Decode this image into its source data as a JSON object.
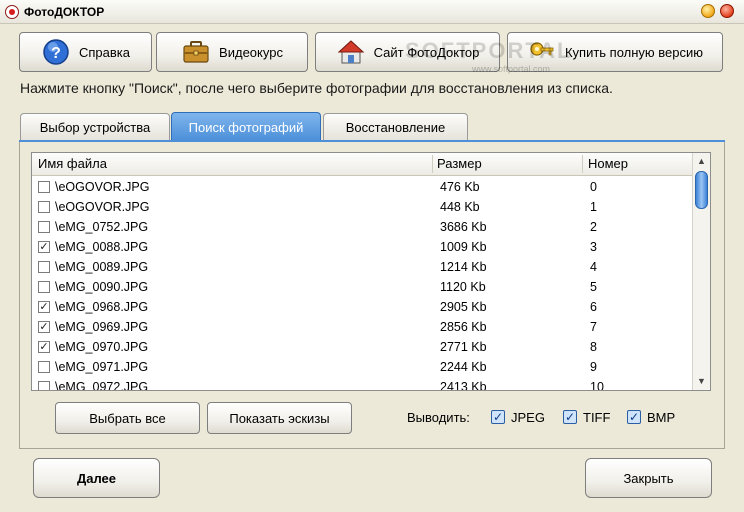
{
  "window": {
    "title": "ФотоДОКТОР"
  },
  "toolbar": {
    "help_label": "Справка",
    "video_label": "Видеокурс",
    "site_label": "Сайт ФотоДоктор",
    "buy_label": "Купить полную версию"
  },
  "watermark": {
    "text": "SOFTPORTAL",
    "url": "www.softportal.com"
  },
  "hint": "Нажмите кнопку \"Поиск\", после чего выберите фотографии для восстановления из списка.",
  "tabs": [
    {
      "label": "Выбор устройства",
      "active": false
    },
    {
      "label": "Поиск фотографий",
      "active": true
    },
    {
      "label": "Восстановление",
      "active": false
    }
  ],
  "table": {
    "columns": [
      "Имя файла",
      "Размер",
      "Номер"
    ],
    "rows": [
      {
        "name": "\\eOGOVOR.JPG",
        "size": "476 Kb",
        "num": "0",
        "checked": false
      },
      {
        "name": "\\eOGOVOR.JPG",
        "size": "448 Kb",
        "num": "1",
        "checked": false
      },
      {
        "name": "\\eMG_0752.JPG",
        "size": "3686 Kb",
        "num": "2",
        "checked": false
      },
      {
        "name": "\\eMG_0088.JPG",
        "size": "1009 Kb",
        "num": "3",
        "checked": true
      },
      {
        "name": "\\eMG_0089.JPG",
        "size": "1214 Kb",
        "num": "4",
        "checked": false
      },
      {
        "name": "\\eMG_0090.JPG",
        "size": "1120 Kb",
        "num": "5",
        "checked": false
      },
      {
        "name": "\\eMG_0968.JPG",
        "size": "2905 Kb",
        "num": "6",
        "checked": true
      },
      {
        "name": "\\eMG_0969.JPG",
        "size": "2856 Kb",
        "num": "7",
        "checked": true
      },
      {
        "name": "\\eMG_0970.JPG",
        "size": "2771 Kb",
        "num": "8",
        "checked": true
      },
      {
        "name": "\\eMG_0971.JPG",
        "size": "2244 Kb",
        "num": "9",
        "checked": false
      },
      {
        "name": "\\eMG_0972.JPG",
        "size": "2413 Kb",
        "num": "10",
        "checked": false
      }
    ]
  },
  "panel": {
    "select_all_label": "Выбрать все",
    "thumbs_label": "Показать эскизы",
    "output_label": "Выводить:",
    "formats": [
      {
        "label": "JPEG",
        "checked": true
      },
      {
        "label": "TIFF",
        "checked": true
      },
      {
        "label": "BMP",
        "checked": true
      }
    ]
  },
  "footer": {
    "next_label": "Далее",
    "close_label": "Закрыть"
  },
  "colors": {
    "accent": "#4d8fd8",
    "tab_active": "#5e9de0",
    "window_bg": "#ece9d8"
  }
}
